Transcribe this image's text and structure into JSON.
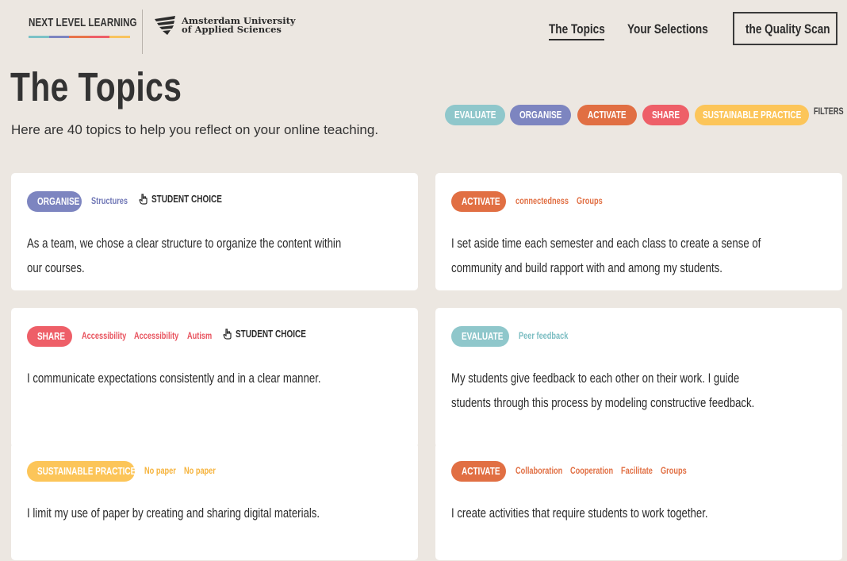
{
  "header": {
    "brand": "NEXT LEVEL LEARNING",
    "brand_colors": [
      "#7cc2c7",
      "#7d85c0",
      "#e8744a",
      "#ee5f68",
      "#f8c35e"
    ],
    "university_line1": "Amsterdam University",
    "university_line2": "of Applied Sciences",
    "nav": {
      "topics": "The Topics",
      "selections": "Your Selections",
      "quality_scan": "the Quality Scan"
    }
  },
  "page": {
    "title": "The Topics",
    "subtitle": "Here are 40 topics to help you reflect on your online teaching."
  },
  "filters": {
    "chips": [
      {
        "label": "EVALUATE",
        "color": "#8fc7cb"
      },
      {
        "label": "ORGANISE",
        "color": "#7d85c0"
      },
      {
        "label": "ACTIVATE",
        "color": "#e16f43"
      },
      {
        "label": "SHARE",
        "color": "#ee5f68"
      },
      {
        "label": "SUSTAINABLE PRACTICE",
        "color": "#fcc559"
      }
    ],
    "label": "FILTERS"
  },
  "cards": [
    {
      "tag": "ORGANISE",
      "tag_color": "#7d85c0",
      "keywords": [
        "Structures"
      ],
      "kw_color": "#7077b6",
      "student_choice": "STUDENT CHOICE",
      "statement_lines": [
        "As a team, we chose a clear structure to organize the content within",
        "our courses."
      ]
    },
    {
      "tag": "ACTIVATE",
      "tag_color": "#e16f43",
      "keywords": [
        "connectedness",
        "Groups"
      ],
      "kw_color": "#e16f43",
      "student_choice": "",
      "statement_lines": [
        "I set aside time each semester and each class to create a sense of",
        "community and build rapport with and among my students."
      ]
    },
    {
      "tag": "SHARE",
      "tag_color": "#ee5f68",
      "keywords": [
        "Accessibility",
        "Accessibility",
        "Autism"
      ],
      "kw_color": "#e8525d",
      "student_choice": "STUDENT CHOICE",
      "statement_lines": [
        "I communicate expectations consistently and in a clear manner."
      ]
    },
    {
      "tag": "EVALUATE",
      "tag_color": "#8fc7cb",
      "keywords": [
        "Peer feedback"
      ],
      "kw_color": "#7bbdc2",
      "student_choice": "",
      "statement_lines": [
        "My students give feedback to each other on their work. I guide",
        "students through this process by modeling constructive feedback."
      ]
    },
    {
      "tag": "SUSTAINABLE PRACTICE",
      "tag_color": "#fcc559",
      "keywords": [
        "No paper",
        "No paper"
      ],
      "kw_color": "#f6b33c",
      "student_choice": "",
      "statement_lines": [
        "I limit my use of paper by creating and sharing digital materials."
      ]
    },
    {
      "tag": "ACTIVATE",
      "tag_color": "#e16f43",
      "keywords": [
        "Collaboration",
        "Cooperation",
        "Facilitate",
        "Groups"
      ],
      "kw_color": "#e16f43",
      "student_choice": "",
      "statement_lines": [
        "I create activities that require students to work together."
      ]
    }
  ]
}
